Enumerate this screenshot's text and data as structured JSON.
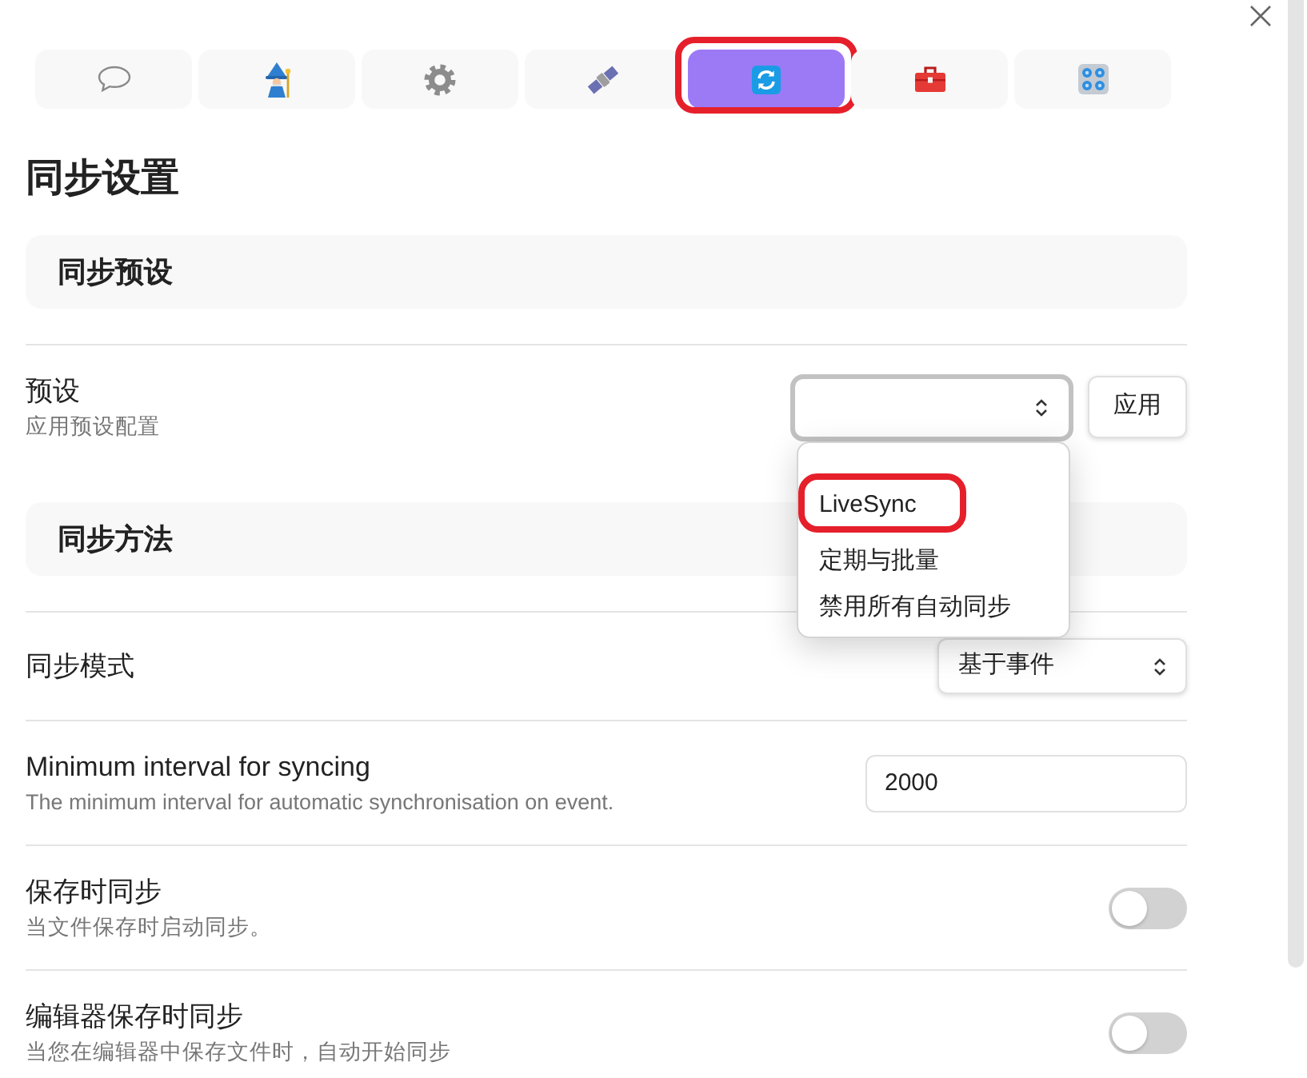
{
  "tabs": [
    {
      "kind": "chat",
      "selected": false,
      "highlighted": false
    },
    {
      "kind": "wizard",
      "selected": false,
      "highlighted": false
    },
    {
      "kind": "gear",
      "selected": false,
      "highlighted": false
    },
    {
      "kind": "satellite",
      "selected": false,
      "highlighted": false
    },
    {
      "kind": "sync",
      "selected": true,
      "highlighted": true
    },
    {
      "kind": "toolbox",
      "selected": false,
      "highlighted": false
    },
    {
      "kind": "knobs",
      "selected": false,
      "highlighted": false
    }
  ],
  "page_title": "同步设置",
  "sections": [
    {
      "heading": "同步预设",
      "settings": [
        {
          "kind": "select",
          "name": "预设",
          "description": "应用预设配置",
          "open": true,
          "options": [
            {
              "label": "LiveSync",
              "selected": false,
              "highlighted": true
            },
            {
              "label": "定期与批量",
              "selected": false,
              "highlighted": false
            },
            {
              "label": "禁用所有自动同步",
              "selected": false,
              "highlighted": false
            }
          ],
          "button": "应用"
        }
      ]
    },
    {
      "heading": "同步方法",
      "settings": [
        {
          "kind": "select",
          "name": "同步模式",
          "value": "基于事件",
          "open": false
        },
        {
          "kind": "number",
          "name": "Minimum interval for syncing",
          "description": "The minimum interval for automatic synchronisation on event.",
          "value": "2000"
        },
        {
          "kind": "toggle",
          "name": "保存时同步",
          "description": "当文件保存时启动同步。",
          "on": false
        },
        {
          "kind": "toggle",
          "name": "编辑器保存时同步",
          "description": "当您在编辑器中保存文件时，自动开始同步",
          "on": false
        }
      ]
    }
  ]
}
